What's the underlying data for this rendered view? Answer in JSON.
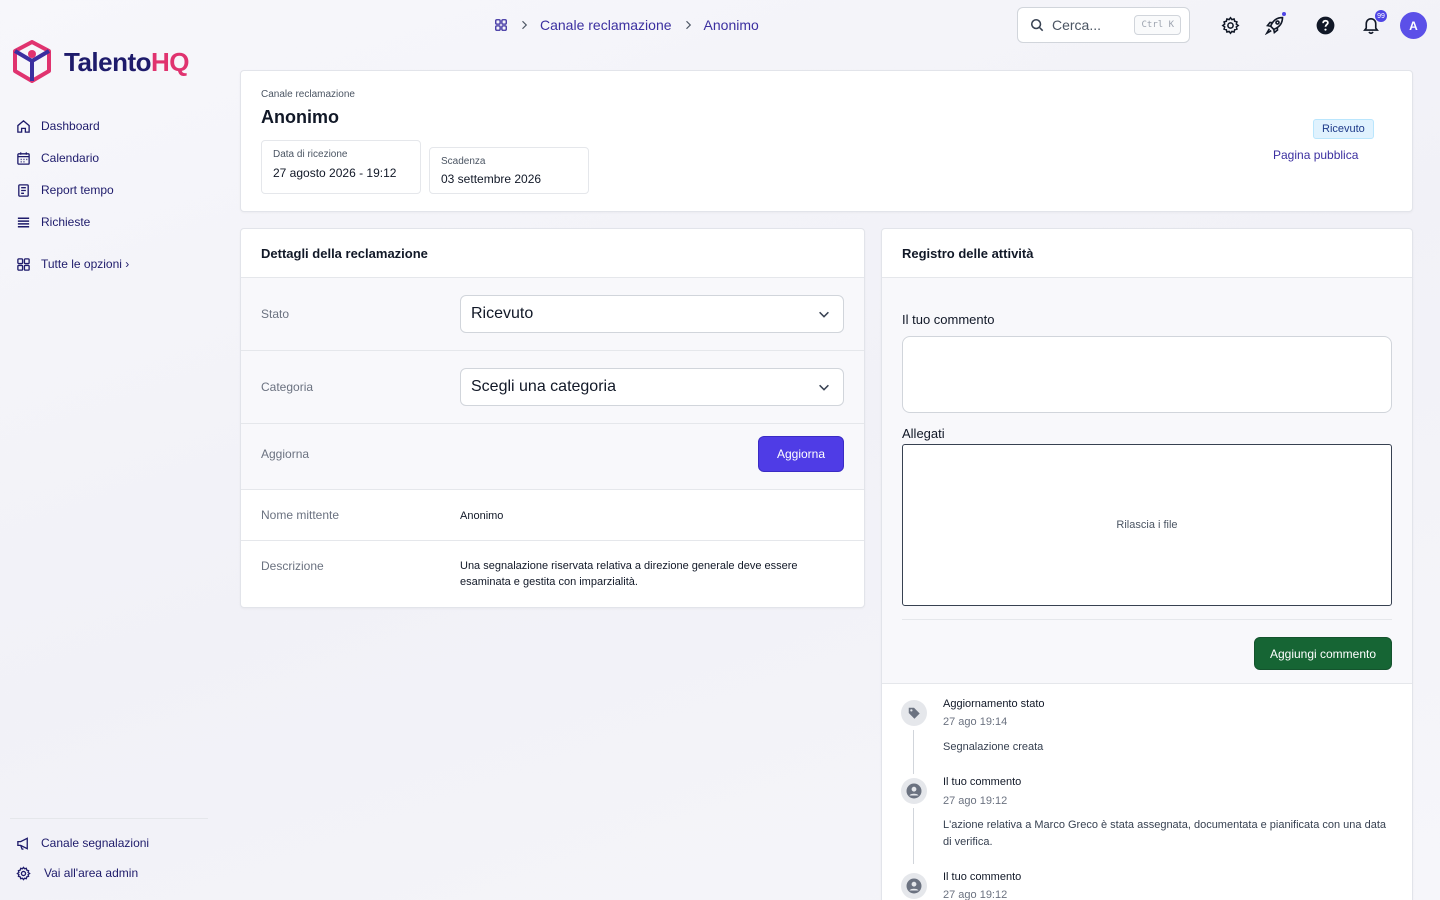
{
  "brand": {
    "name_main": "Talento",
    "name_accent": "HQ",
    "accent_color": "#e0336f",
    "primary_color": "#1e1b6b"
  },
  "sidebar": {
    "items": [
      {
        "label": "Dashboard",
        "icon": "home-icon"
      },
      {
        "label": "Calendario",
        "icon": "calendar-icon"
      },
      {
        "label": "Report tempo",
        "icon": "report-icon"
      },
      {
        "label": "Richieste",
        "icon": "list-icon"
      }
    ],
    "all_options": "Tutte le opzioni ›",
    "bottom": [
      {
        "label": "Canale segnalazioni",
        "icon": "megaphone-icon"
      },
      {
        "label": "Vai all'area admin",
        "icon": "gear-icon"
      }
    ]
  },
  "topbar": {
    "breadcrumb": [
      "Canale reclamazione",
      "Anonimo"
    ],
    "search_placeholder": "Cerca...",
    "search_shortcut": "Ctrl K",
    "notification_count": "99",
    "avatar_initial": "A"
  },
  "header": {
    "subtitle": "Canale reclamazione",
    "title": "Anonimo",
    "received_label": "Data di ricezione",
    "received_value": "27 agosto 2026 - 19:12",
    "deadline_label": "Scadenza",
    "deadline_value": "03 settembre 2026",
    "status_badge": "Ricevuto",
    "public_link": "Pagina pubblica"
  },
  "details": {
    "title": "Dettagli della reclamazione",
    "state_label": "Stato",
    "state_value": "Ricevuto",
    "category_label": "Categoria",
    "category_value": "Scegli una categoria",
    "update_label": "Aggiorna",
    "update_button": "Aggiorna",
    "sender_label": "Nome mittente",
    "sender_value": "Anonimo",
    "description_label": "Descrizione",
    "description_value": "Una segnalazione riservata relativa a direzione generale deve essere esaminata e gestita con imparzialità."
  },
  "activity": {
    "title": "Registro delle attività",
    "comment_label": "Il tuo commento",
    "attachments_label": "Allegati",
    "dropzone_text": "Rilascia i file",
    "add_comment_button": "Aggiungi commento",
    "entries": [
      {
        "title": "Aggiornamento stato",
        "time": "27 ago 19:14",
        "text": "Segnalazione creata",
        "icon": "tag-icon"
      },
      {
        "title": "Il tuo commento",
        "time": "27 ago 19:12",
        "text": "L'azione relativa a Marco Greco è stata assegnata, documentata e pianificata con una data di verifica.",
        "icon": "user-icon"
      },
      {
        "title": "Il tuo commento",
        "time": "27 ago 19:12",
        "text": "",
        "icon": "user-icon"
      }
    ]
  }
}
